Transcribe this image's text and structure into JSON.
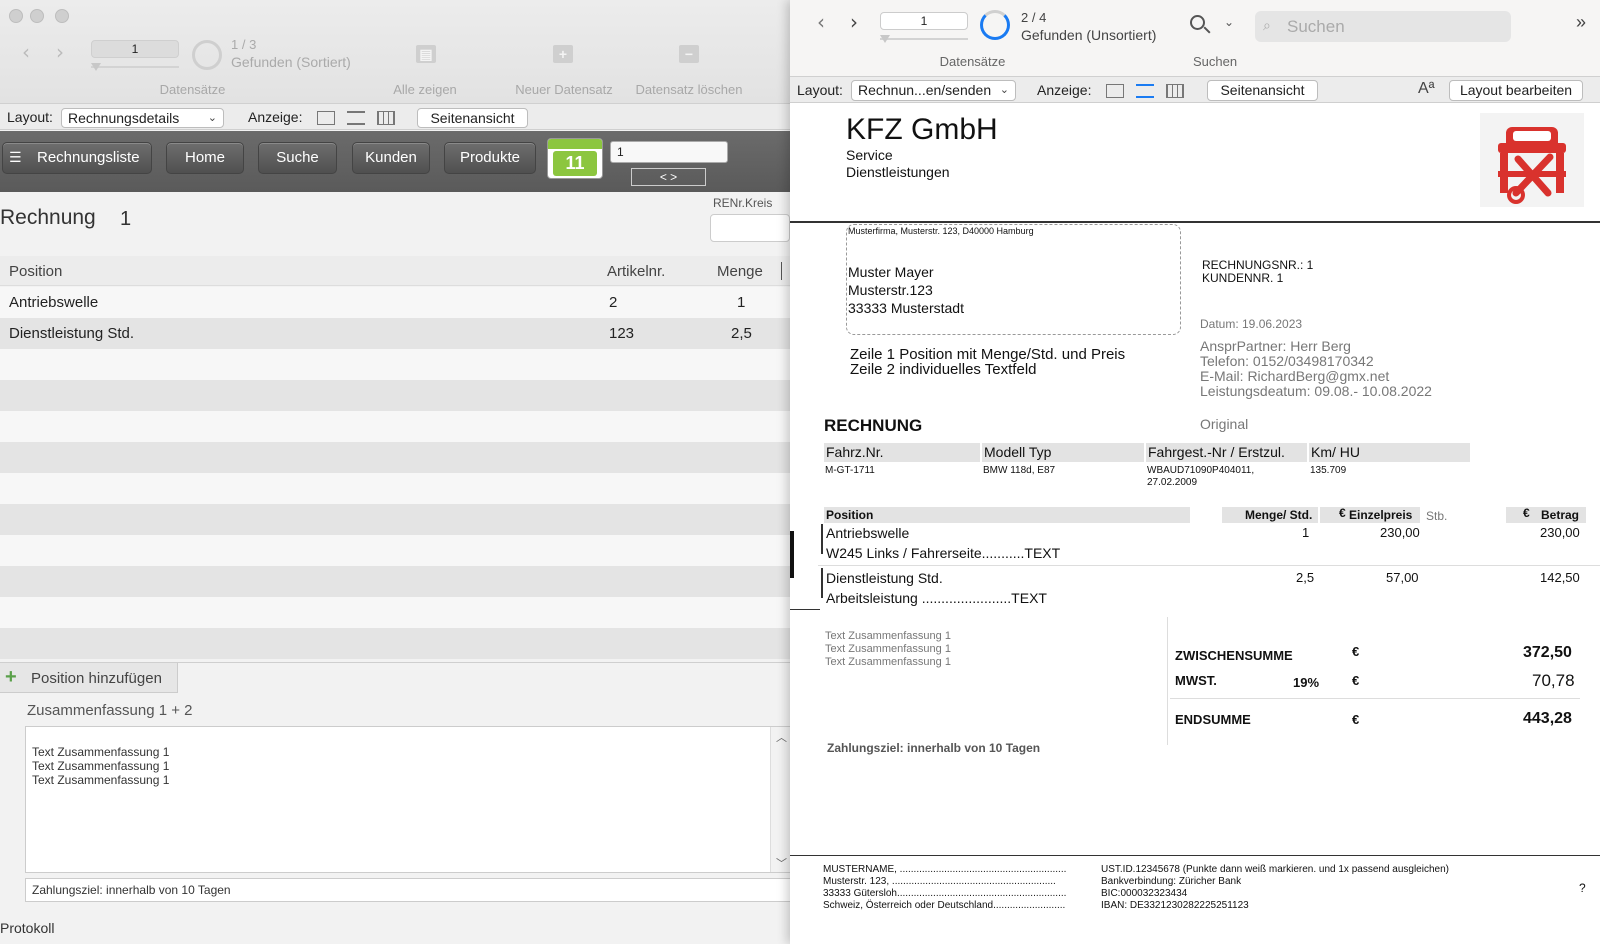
{
  "left": {
    "toolbar": {
      "record_number": "1",
      "found_count": "1 / 3",
      "found_label": "Gefunden (Sortiert)",
      "records_caption": "Datensätze",
      "show_all": "Alle zeigen",
      "new_record": "Neuer Datensatz",
      "delete_record": "Datensatz löschen"
    },
    "layoutbar": {
      "layout_label": "Layout:",
      "layout_value": "Rechnungsdetails",
      "view_label": "Anzeige:",
      "page_view": "Seitenansicht"
    },
    "navbar": {
      "list": "Rechnungsliste",
      "home": "Home",
      "search": "Suche",
      "customers": "Kunden",
      "products": "Produkte",
      "calendar_day": "11",
      "nav_field": "1",
      "nav_arrows": "< >"
    },
    "invoice": {
      "title": "Rechnung",
      "number": "1",
      "renr_label": "RENr.Kreis"
    },
    "table": {
      "headers": [
        "Position",
        "Artikelnr.",
        "Menge"
      ],
      "rows": [
        [
          "Antriebswelle",
          "2",
          "1"
        ],
        [
          "Dienstleistung Std.",
          "123",
          "2,5"
        ]
      ]
    },
    "add_position": "Position hinzufügen",
    "summary_label": "Zusammenfassung 1 + 2",
    "summary_lines": [
      "Text Zusammenfassung 1",
      "Text Zusammenfassung 1",
      "Text Zusammenfassung 1"
    ],
    "payment_terms": "Zahlungsziel: innerhalb von 10 Tagen",
    "protocol": "Protokoll"
  },
  "right": {
    "toolbar": {
      "record_number": "1",
      "found_count": "2 / 4",
      "found_label": "Gefunden (Unsortiert)",
      "records_caption": "Datensätze",
      "search_caption": "Suchen",
      "search_placeholder": "Suchen"
    },
    "layoutbar": {
      "layout_label": "Layout:",
      "layout_value": "Rechnun...en/senden",
      "view_label": "Anzeige:",
      "page_view": "Seitenansicht",
      "font_icon": "Aª",
      "edit_layout": "Layout bearbeiten"
    },
    "doc": {
      "company": "KFZ GmbH",
      "company_sub1": "Service",
      "company_sub2": "Dienstleistungen",
      "sender_line": "Musterfirma, Musterstr. 123, D40000 Hamburg",
      "recipient": [
        "Muster Mayer",
        "Musterstr.123",
        "33333 Musterstadt"
      ],
      "invoice_no": "RECHNUNGSNR.: 1",
      "customer_no": "KUNDENNR.  1",
      "date": "Datum: 19.06.2023",
      "contact": "AnsprPartner: Herr Berg",
      "phone": "Telefon: 0152/03498170342",
      "email": "E-Mail: RichardBerg@gmx.net",
      "service_date": "Leistungsdeatum: 09.08.- 10.08.2022",
      "intro1": "Zeile 1 Position mit Menge/Std. und Preis",
      "intro2": "Zeile 2 individuelles Textfeld",
      "heading": "RECHNUNG",
      "original": "Original",
      "vehicle_headers": [
        "Fahrz.Nr.",
        "Modell Typ",
        "Fahrgest.-Nr / Erstzul.",
        "Km/ HU"
      ],
      "vehicle_values": [
        "M-GT-1711",
        "BMW 118d, E87",
        "WBAUD71090P404011,",
        "135.709"
      ],
      "vehicle_reg_date": "27.02.2009",
      "pos_headers": {
        "position": "Position",
        "qty": "Menge/ Std.",
        "unit_euro": "€",
        "unit_price": "Einzelpreis",
        "pcs": "Stb.",
        "amount_euro": "€",
        "amount": "Betrag"
      },
      "positions": [
        {
          "name": "Antriebswelle",
          "detail": "W245 Links / Fahrerseite...........TEXT",
          "qty": "1",
          "price": "230,00",
          "amount": "230,00"
        },
        {
          "name": "Dienstleistung Std.",
          "detail": "Arbeitsleistung .......................TEXT",
          "qty": "2,5",
          "price": "57,00",
          "amount": "142,50"
        }
      ],
      "summary_lines": [
        "Text Zusammenfassung 1",
        "Text Zusammenfassung 1",
        "Text Zusammenfassung 1"
      ],
      "subtotal_label": "ZWISCHENSUMME",
      "subtotal_currency": "€",
      "subtotal": "372,50",
      "vat_label": "MWST.",
      "vat_rate": "19%",
      "vat_currency": "€",
      "vat": "70,78",
      "total_label": "ENDSUMME",
      "total_currency": "€",
      "total": "443,28",
      "payment_terms": "Zahlungsziel: innerhalb von 10 Tagen",
      "footer_left": [
        "MUSTERNAME, ............................................................",
        "Musterstr. 123, ...........................................................",
        "33333 Gütersloh.............................................................",
        "Schweiz, Österreich oder Deutschland.........................."
      ],
      "footer_right": [
        "UST.ID.12345678 (Punkte dann weiß markieren. und 1x passend ausgleichen)",
        "Bankverbindung: Züricher Bank",
        "BIC:000032323434",
        "IBAN: DE3321230282225251123"
      ],
      "help": "?"
    }
  }
}
